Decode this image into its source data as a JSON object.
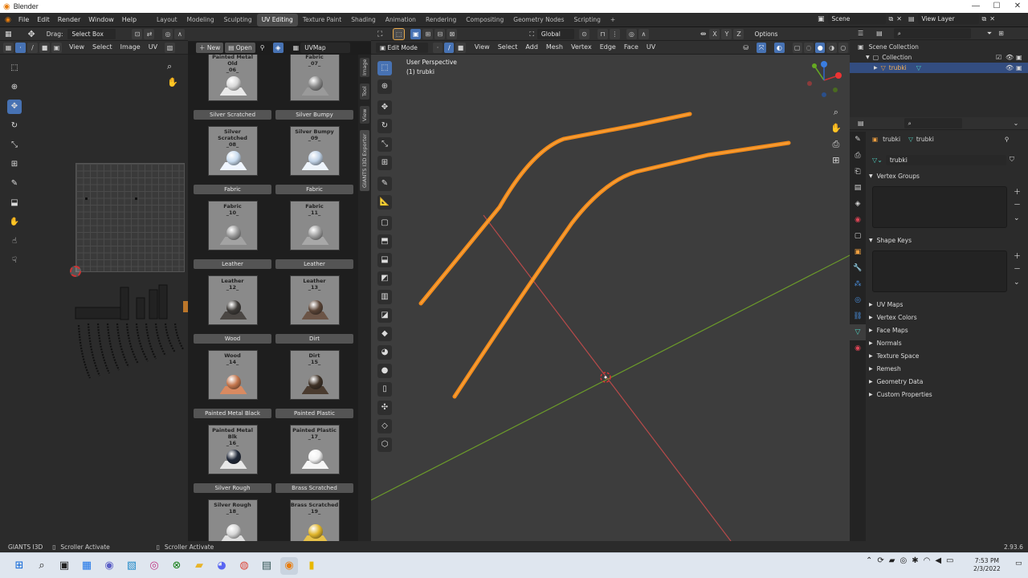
{
  "window": {
    "title": "Blender",
    "minimize": "—",
    "maximize": "☐",
    "close": "✕"
  },
  "menubar": {
    "menus": [
      "File",
      "Edit",
      "Render",
      "Window",
      "Help"
    ],
    "workspaces": [
      "Layout",
      "Modeling",
      "Sculpting",
      "UV Editing",
      "Texture Paint",
      "Shading",
      "Animation",
      "Rendering",
      "Compositing",
      "Geometry Nodes",
      "Scripting"
    ],
    "active_workspace": "UV Editing",
    "add_tab": "+",
    "scene": "Scene",
    "view_layer": "View Layer"
  },
  "uv_editor": {
    "drag_label": "Drag:",
    "drag_value": "Select Box",
    "menus": [
      "View",
      "Select",
      "Image",
      "UV"
    ],
    "new_label": "New",
    "open_label": "Open",
    "uvmap": "UVMap"
  },
  "side_tabs": [
    "Image",
    "Tool",
    "View",
    "GIANTS I3D Exporter"
  ],
  "materials": [
    {
      "title": "",
      "thumb": "Painted Metal Old\n_06_",
      "ball": "#d8d8d8",
      "base": "#e9e9e9"
    },
    {
      "title": "",
      "thumb": "Fabric\n_07_",
      "ball": "#8a8a8a",
      "base": "#9a9a9a"
    },
    {
      "title": "Silver Scratched",
      "thumb": "Silver Scratched\n_08_",
      "ball": "#c9dcef",
      "base": "#f0f6ff"
    },
    {
      "title": "Silver Bumpy",
      "thumb": "Silver Bumpy\n_09_",
      "ball": "#c0d2e6",
      "base": "#eef4fb"
    },
    {
      "title": "Fabric",
      "thumb": "Fabric\n_10_",
      "ball": "#9a9a9a",
      "base": "#a3a3a3"
    },
    {
      "title": "Fabric",
      "thumb": "Fabric\n_11_",
      "ball": "#a0a0a0",
      "base": "#a8a8a8"
    },
    {
      "title": "Leather",
      "thumb": "Leather\n_12_",
      "ball": "#3d3a37",
      "base": "#4a4643"
    },
    {
      "title": "Leather",
      "thumb": "Leather\n_13_",
      "ball": "#5a4436",
      "base": "#6b5446"
    },
    {
      "title": "Wood",
      "thumb": "Wood\n_14_",
      "ball": "#c5774e",
      "base": "#d98a61"
    },
    {
      "title": "Dirt",
      "thumb": "Dirt\n_15_",
      "ball": "#3e3126",
      "base": "#4a3b2f"
    },
    {
      "title": "Painted Metal Black",
      "thumb": "Painted Metal Blk\n_16_",
      "ball": "#202838",
      "base": "#e8e8e8"
    },
    {
      "title": "Painted Plastic",
      "thumb": "Painted Plastic\n_17_",
      "ball": "#f2f2f2",
      "base": "#f7f7f7"
    },
    {
      "title": "Silver Rough",
      "thumb": "Silver Rough\n_18_",
      "ball": "#d6d6d6",
      "base": "#e0e0e0"
    },
    {
      "title": "Brass Scratched",
      "thumb": "Brass Scratched\n_19_",
      "ball": "#e0b52a",
      "base": "#e7c24a"
    }
  ],
  "viewport": {
    "mode": "Edit Mode",
    "menus": [
      "View",
      "Select",
      "Add",
      "Mesh",
      "Vertex",
      "Edge",
      "Face",
      "UV"
    ],
    "orientation": "Global",
    "options": "Options",
    "axes": [
      "X",
      "Y",
      "Z"
    ],
    "info_line1": "User Perspective",
    "info_line2": "(1) trubki",
    "accent": "#f28c1c"
  },
  "outliner": {
    "scene_collection": "Scene Collection",
    "collection": "Collection",
    "object": "trubki"
  },
  "properties": {
    "breadcrumb_object": "trubki",
    "breadcrumb_mesh": "trubki",
    "mesh_name": "trubki",
    "vertex_groups": "Vertex Groups",
    "shape_keys": "Shape Keys",
    "collapsed": [
      "UV Maps",
      "Vertex Colors",
      "Face Maps",
      "Normals",
      "Texture Space",
      "Remesh",
      "Geometry Data",
      "Custom Properties"
    ]
  },
  "statusbar": {
    "left": "GIANTS I3D",
    "mid": "Scroller Activate",
    "mid2": "Scroller Activate",
    "version": "2.93.6"
  },
  "taskbar": {
    "time": "7:53 PM",
    "date": "2/3/2022"
  }
}
